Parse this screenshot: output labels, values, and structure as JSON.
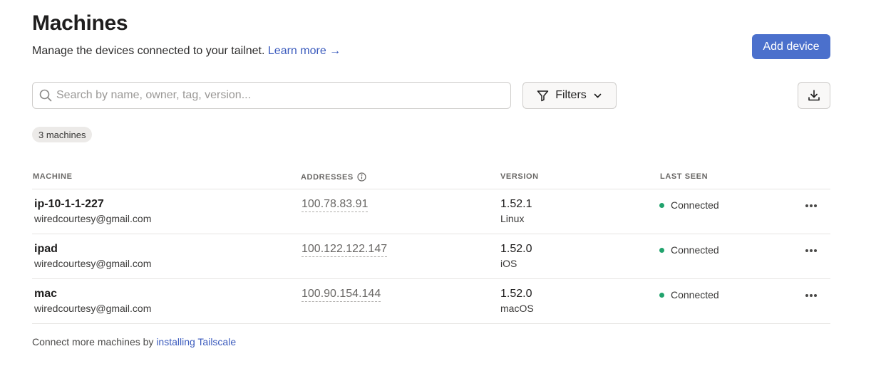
{
  "header": {
    "title": "Machines",
    "subtitle": "Manage the devices connected to your tailnet.",
    "learn_more": "Learn more →",
    "add_device_label": "Add device"
  },
  "search": {
    "placeholder": "Search by name, owner, tag, version...",
    "value": ""
  },
  "filters": {
    "label": "Filters"
  },
  "count_badge": "3 machines",
  "table": {
    "columns": [
      "MACHINE",
      "ADDRESSES",
      "VERSION",
      "LAST SEEN"
    ],
    "rows": [
      {
        "name": "ip-10-1-1-227",
        "owner": "wiredcourtesy@gmail.com",
        "address": "100.78.83.91",
        "version": "1.52.1",
        "os": "Linux",
        "last_seen": "Connected"
      },
      {
        "name": "ipad",
        "owner": "wiredcourtesy@gmail.com",
        "address": "100.122.122.147",
        "version": "1.52.0",
        "os": "iOS",
        "last_seen": "Connected"
      },
      {
        "name": "mac",
        "owner": "wiredcourtesy@gmail.com",
        "address": "100.90.154.144",
        "version": "1.52.0",
        "os": "macOS",
        "last_seen": "Connected"
      }
    ]
  },
  "footer": {
    "text": "Connect more machines by",
    "link": "installing Tailscale"
  },
  "icons": [
    "search-icon",
    "filter-icon",
    "chevron-down-icon",
    "download-icon",
    "info-icon",
    "more-horizontal-icon"
  ],
  "colors": {
    "accent": "#4b70cc",
    "link": "#3b5bbd",
    "connected": "#21a36d"
  }
}
